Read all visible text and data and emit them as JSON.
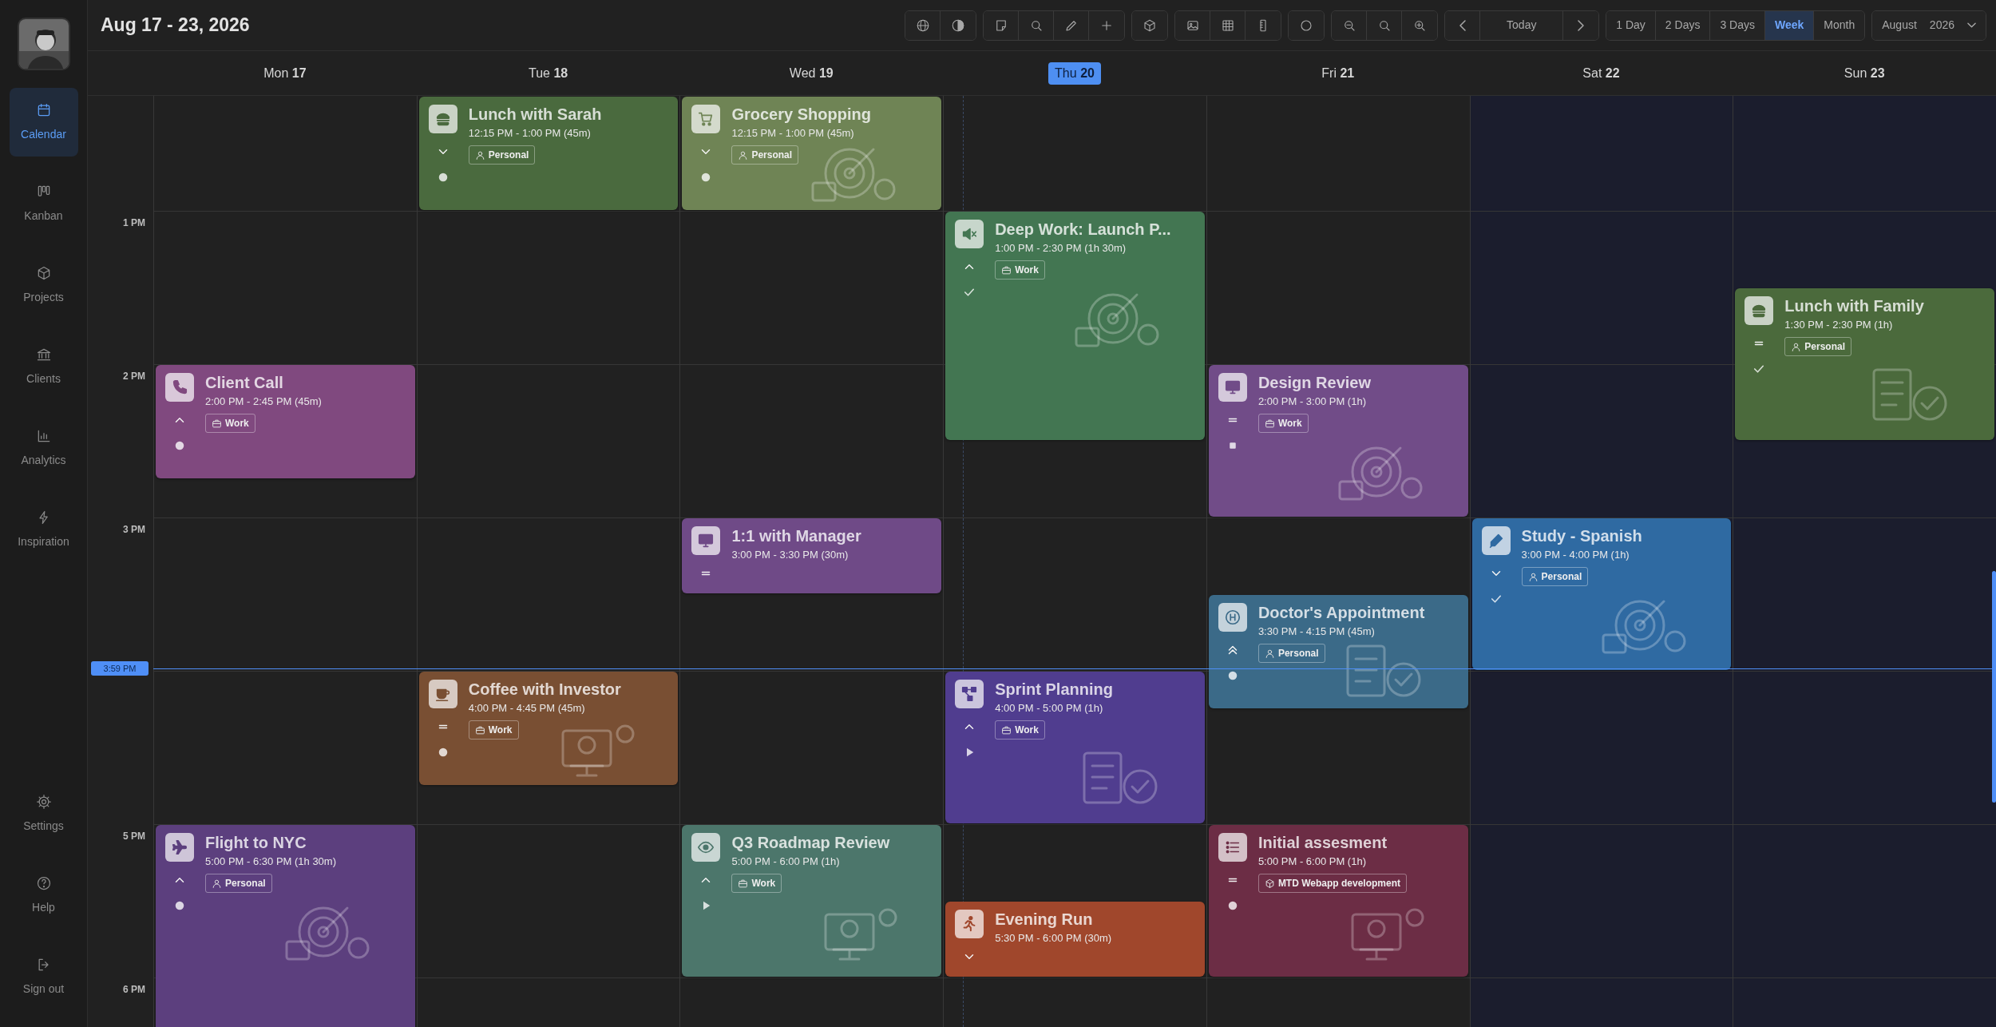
{
  "header": {
    "title": "Aug 17 - 23, 2026"
  },
  "navigation": {
    "today": "Today"
  },
  "views": [
    {
      "label": "1 Day",
      "selected": false
    },
    {
      "label": "2 Days",
      "selected": false
    },
    {
      "label": "3 Days",
      "selected": false
    },
    {
      "label": "Week",
      "selected": true
    },
    {
      "label": "Month",
      "selected": false
    }
  ],
  "month_picker": {
    "month": "August",
    "year": "2026"
  },
  "sidebar": {
    "items": [
      {
        "label": "Calendar",
        "selected": true
      },
      {
        "label": "Kanban",
        "selected": false
      },
      {
        "label": "Projects",
        "selected": false
      },
      {
        "label": "Clients",
        "selected": false
      },
      {
        "label": "Analytics",
        "selected": false
      },
      {
        "label": "Inspiration",
        "selected": false
      }
    ],
    "bottom_items": [
      {
        "label": "Settings",
        "selected": false
      },
      {
        "label": "Help",
        "selected": false
      },
      {
        "label": "Sign out",
        "selected": false
      }
    ]
  },
  "time_labels": [
    "1 PM",
    "2 PM",
    "3 PM",
    "5 PM",
    "6 PM"
  ],
  "now": {
    "label": "3:59 PM"
  },
  "days": [
    {
      "weekday": "Mon",
      "date": "17",
      "today": false,
      "weekend": false,
      "events": [
        {
          "title": "Client Call",
          "time": "2:00 PM - 2:45 PM (45m)",
          "color": "#80497f",
          "tag": {
            "kind": "work",
            "label": "Work"
          },
          "priority": {
            "kind": "high"
          },
          "status": {
            "kind": "todo"
          },
          "illustration": false
        },
        {
          "title": "Flight to NYC",
          "time": "5:00 PM - 6:30 PM (1h 30m)",
          "color": "#5c3f7e",
          "tag": {
            "kind": "personal",
            "label": "Personal"
          },
          "priority": {
            "kind": "high"
          },
          "status": {
            "kind": "todo"
          },
          "illustration": true
        }
      ]
    },
    {
      "weekday": "Tue",
      "date": "18",
      "today": false,
      "weekend": false,
      "events": [
        {
          "title": "Lunch with Sarah",
          "time": "12:15 PM - 1:00 PM (45m)",
          "color": "#4a6a3e",
          "tag": {
            "kind": "personal",
            "label": "Personal"
          },
          "priority": {
            "kind": "low"
          },
          "status": {
            "kind": "todo"
          },
          "illustration": false
        },
        {
          "title": "Coffee with Investor",
          "time": "4:00 PM - 4:45 PM (45m)",
          "color": "#794f33",
          "tag": {
            "kind": "work",
            "label": "Work"
          },
          "priority": {
            "kind": "medium"
          },
          "status": {
            "kind": "todo"
          },
          "illustration": true
        }
      ]
    },
    {
      "weekday": "Wed",
      "date": "19",
      "today": false,
      "weekend": false,
      "events": [
        {
          "title": "Grocery Shopping",
          "time": "12:15 PM - 1:00 PM (45m)",
          "color": "#6f8455",
          "tag": {
            "kind": "personal",
            "label": "Personal"
          },
          "priority": {
            "kind": "low"
          },
          "status": {
            "kind": "todo"
          },
          "illustration": true
        },
        {
          "title": "1:1 with Manager",
          "time": "3:00 PM - 3:30 PM (30m)",
          "color": "#6f4a87",
          "priority": {
            "kind": "medium"
          },
          "illustration": false
        },
        {
          "title": "Q3 Roadmap Review",
          "time": "5:00 PM - 6:00 PM (1h)",
          "color": "#4c766b",
          "tag": {
            "kind": "work",
            "label": "Work"
          },
          "priority": {
            "kind": "high"
          },
          "status": {
            "kind": "running"
          },
          "illustration": true
        }
      ]
    },
    {
      "weekday": "Thu",
      "date": "20",
      "today": true,
      "weekend": false,
      "events": [
        {
          "title": "Deep Work: Launch P...",
          "time": "1:00 PM - 2:30 PM (1h 30m)",
          "color": "#437652",
          "tag": {
            "kind": "work",
            "label": "Work"
          },
          "priority": {
            "kind": "high"
          },
          "status": {
            "kind": "done"
          },
          "illustration": true
        },
        {
          "title": "Sprint Planning",
          "time": "4:00 PM - 5:00 PM (1h)",
          "color": "#503d8f",
          "tag": {
            "kind": "work",
            "label": "Work"
          },
          "priority": {
            "kind": "high"
          },
          "status": {
            "kind": "running"
          },
          "illustration": true
        },
        {
          "title": "Evening Run",
          "time": "5:30 PM - 6:00 PM (30m)",
          "color": "#a0472c",
          "priority": {
            "kind": "low"
          },
          "illustration": false
        }
      ]
    },
    {
      "weekday": "Fri",
      "date": "21",
      "today": false,
      "weekend": false,
      "events": [
        {
          "title": "Design Review",
          "time": "2:00 PM - 3:00 PM (1h)",
          "color": "#714c88",
          "tag": {
            "kind": "work",
            "label": "Work"
          },
          "priority": {
            "kind": "medium"
          },
          "status": {
            "kind": "stopped"
          },
          "illustration": true
        },
        {
          "title": "Doctor's Appointment",
          "time": "3:30 PM - 4:15 PM (45m)",
          "color": "#3b6a88",
          "tag": {
            "kind": "personal",
            "label": "Personal"
          },
          "priority": {
            "kind": "urgent"
          },
          "status": {
            "kind": "todo"
          },
          "illustration": true
        },
        {
          "title": "Initial assesment",
          "time": "5:00 PM - 6:00 PM (1h)",
          "color": "#6c2d45",
          "tag": {
            "kind": "project",
            "label": "MTD Webapp development"
          },
          "priority": {
            "kind": "medium"
          },
          "status": {
            "kind": "todo"
          },
          "illustration": true
        }
      ]
    },
    {
      "weekday": "Sat",
      "date": "22",
      "today": false,
      "weekend": true,
      "events": [
        {
          "title": "Study - Spanish",
          "time": "3:00 PM - 4:00 PM (1h)",
          "color": "#2f6aa2",
          "tag": {
            "kind": "personal",
            "label": "Personal"
          },
          "priority": {
            "kind": "low"
          },
          "status": {
            "kind": "done"
          },
          "illustration": true
        }
      ]
    },
    {
      "weekday": "Sun",
      "date": "23",
      "today": false,
      "weekend": true,
      "events": [
        {
          "title": "Lunch with Family",
          "time": "1:30 PM - 2:30 PM (1h)",
          "color": "#4b6a3c",
          "tag": {
            "kind": "personal",
            "label": "Personal"
          },
          "priority": {
            "kind": "medium"
          },
          "status": {
            "kind": "done"
          },
          "illustration": true
        }
      ]
    }
  ]
}
